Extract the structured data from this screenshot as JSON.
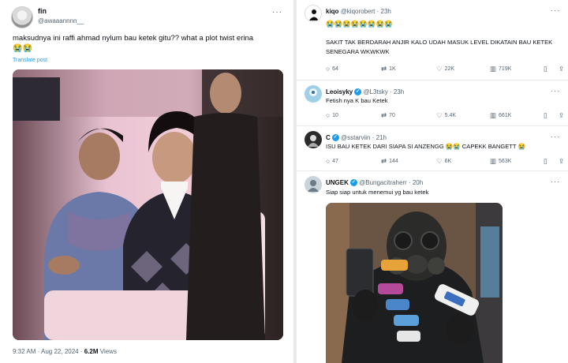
{
  "main_tweet": {
    "name": "fin",
    "handle": "@awaaannnn__",
    "text": "maksudnya ini raffi ahmad nylum bau ketek gitu?? what a plot twist erina",
    "emojis": "😭😭",
    "translate": "Translate post",
    "time": "9:32 AM · Aug 22, 2024 · ",
    "views_count": "6.2M",
    "views_label": " Views"
  },
  "replies": [
    {
      "name": "kiqo",
      "handle": "@kiqorobert · 23h",
      "verified": false,
      "avatar_color": "#ffffff",
      "text": "SAKIT TAK BERDARAH ANJIR KALO UDAH MASUK LEVEL DIKATAIN BAU KETEK SENEGARA WKWKWK",
      "emojis": "😭😭😭😭😭😭😭😭",
      "replies": "64",
      "reposts": "1K",
      "likes": "22K",
      "views": "719K"
    },
    {
      "name": "Leoisyky",
      "handle": "@L3tsky · 23h",
      "verified": true,
      "avatar_color": "#9fd0e8",
      "text": "Fetish nya K bau Ketek",
      "replies": "10",
      "reposts": "70",
      "likes": "5.4K",
      "views": "661K"
    },
    {
      "name": "C",
      "handle": "@sstarviin · 21h",
      "verified": true,
      "avatar_color": "#2b2b2b",
      "text": "ISU BAU KETEK DARI SIAPA SI ANZENGG 😭😭 CAPEKK BANGETT 😭",
      "replies": "47",
      "reposts": "144",
      "likes": "6K",
      "views": "563K"
    },
    {
      "name": "UNGEK",
      "handle": "@Bungacitraherr · 20h",
      "verified": true,
      "avatar_color": "#c9d3da",
      "text": "Siap siap untuk menemui yg bau ketek"
    }
  ],
  "icons": {
    "reply": "reply-icon",
    "repost": "repost-icon",
    "like": "like-icon",
    "views": "views-icon",
    "bookmark": "bookmark-icon",
    "share": "share-icon"
  },
  "colors": {
    "link": "#1d9bf0",
    "muted": "#536471",
    "verified": "#1d9bf0"
  }
}
